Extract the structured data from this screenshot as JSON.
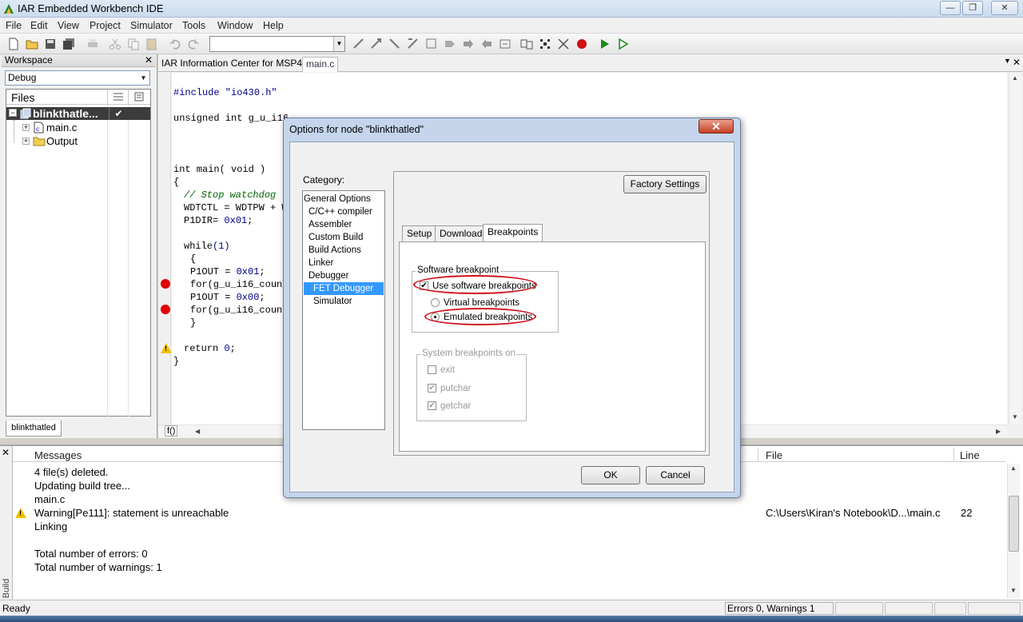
{
  "window": {
    "title": "IAR Embedded Workbench IDE",
    "minimize": "—",
    "maximize": "❐",
    "close": "✕"
  },
  "menu": [
    "File",
    "Edit",
    "View",
    "Project",
    "Simulator",
    "Tools",
    "Window",
    "Help"
  ],
  "workspace": {
    "header": "Workspace",
    "config": "Debug",
    "files_header": "Files",
    "project": "blinkthatle...",
    "check": "✔",
    "items": [
      "main.c",
      "Output"
    ],
    "tab": "blinkthatled"
  },
  "editor": {
    "tabs": [
      "IAR Information Center for MSP430",
      "main.c"
    ],
    "lines": {
      "l1": "#include \"io430.h\"",
      "l2": "unsigned int g_u_i16",
      "l3a": "int main( void )",
      "l3b": "{",
      "l4": "// Stop watchdog t",
      "l5": "WDTCTL = WDTPW + W",
      "l6a": "P1DIR= ",
      "l6b": "0x01",
      "l6c": ";",
      "l7a": "while",
      "l7b": "(1)",
      "l8": "{",
      "l9a": "P1OUT = ",
      "l9b": "0x01",
      "l9c": ";",
      "l10": "for(g_u_i16_count",
      "l11a": "P1OUT = ",
      "l11b": "0x00",
      "l11c": ";",
      "l12": "for(g_u_i16_count",
      "l13": "}",
      "l14a": "return ",
      "l14b": "0",
      "l14c": ";",
      "l15": "}"
    },
    "hscroll_label": "f()"
  },
  "dialog": {
    "title": "Options for node \"blinkthatled\"",
    "close": "✕",
    "category_label": "Category:",
    "categories": [
      "General Options",
      "C/C++ compiler",
      "Assembler",
      "Custom Build",
      "Build Actions",
      "Linker",
      "Debugger",
      "FET Debugger",
      "Simulator"
    ],
    "selected_category": "FET Debugger",
    "factory_settings": "Factory Settings",
    "tabs": [
      "Setup",
      "Download",
      "Breakpoints"
    ],
    "active_tab": "Breakpoints",
    "software_group": "Software breakpoint",
    "use_software": "Use software breakpoints",
    "virtual": "Virtual breakpoints",
    "emulated": "Emulated breakpoints",
    "system_group": "System breakpoints on",
    "system_items": [
      "exit",
      "putchar",
      "getchar"
    ],
    "ok": "OK",
    "cancel": "Cancel"
  },
  "messages": {
    "columns": {
      "messages": "Messages",
      "file": "File",
      "line": "Line"
    },
    "side_label": "Build",
    "rows": [
      {
        "text": "4 file(s) deleted.",
        "file": "",
        "line": ""
      },
      {
        "text": "Updating build tree...",
        "file": "",
        "line": ""
      },
      {
        "text": "main.c",
        "file": "",
        "line": ""
      },
      {
        "text": "Warning[Pe111]: statement is unreachable",
        "file": "C:\\Users\\Kiran's Notebook\\D...\\main.c",
        "line": "22"
      },
      {
        "text": "Linking",
        "file": "",
        "line": ""
      },
      {
        "text": "",
        "file": "",
        "line": ""
      },
      {
        "text": "Total number of errors: 0",
        "file": "",
        "line": ""
      },
      {
        "text": "Total number of warnings: 1",
        "file": "",
        "line": ""
      }
    ]
  },
  "status": {
    "left": "Ready",
    "errors": "Errors 0, Warnings 1"
  },
  "colors": {
    "selection": "#3399ff",
    "breakpoint": "#e00000",
    "highlight": "#d0101a"
  }
}
